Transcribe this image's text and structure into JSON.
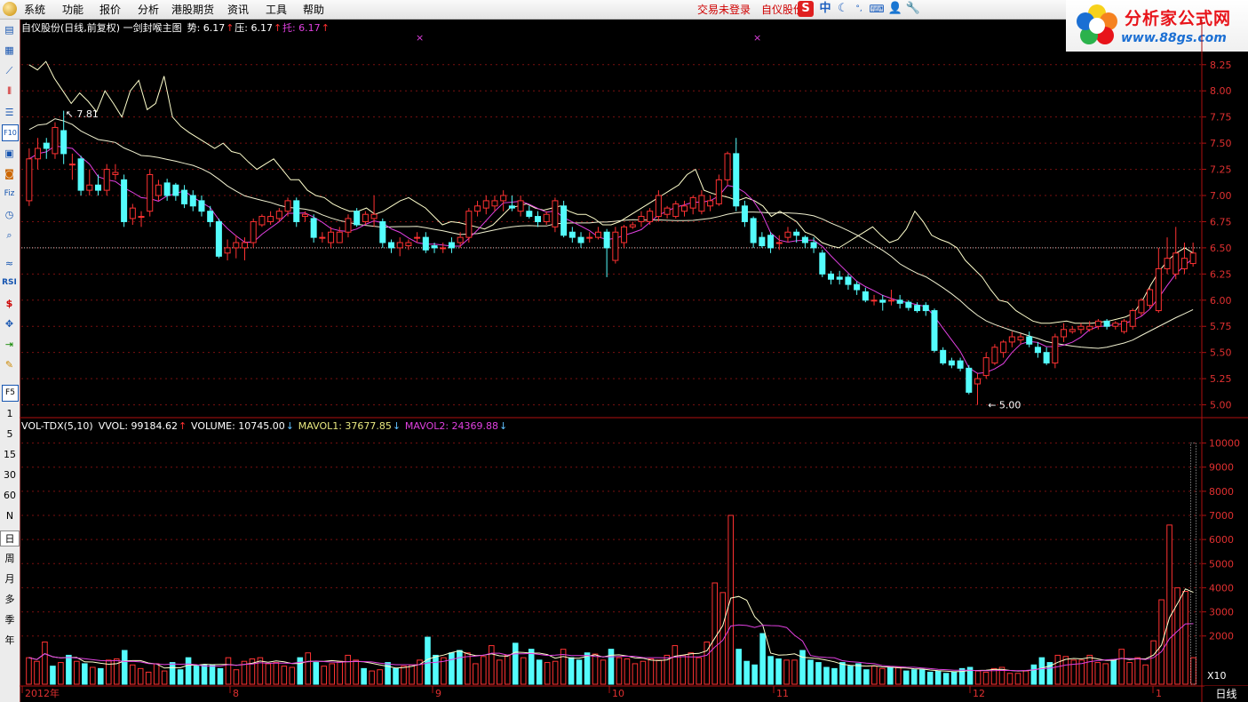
{
  "menu": [
    "系统",
    "功能",
    "报价",
    "分析",
    "港股期货",
    "资讯",
    "工具",
    "帮助"
  ],
  "trade_status": "交易未登录",
  "stock_tab": "自仪股份",
  "toolbar_icons": [
    "sina-s-icon",
    "chinese-input-icon",
    "moon-icon",
    "dot-icon",
    "keyboard-icon",
    "user-icon",
    "wrench-icon"
  ],
  "brand": {
    "title": "分析家公式网",
    "url": "www.88gs.com"
  },
  "sidebar": {
    "icons": [
      "report-icon",
      "grid-icon",
      "line-chart-icon",
      "candle-icon",
      "list-icon",
      "f10-icon",
      "news-icon",
      "info-icon",
      "fiz-icon",
      "clock-icon",
      "search-icon",
      "wave-icon",
      "rsi-icon",
      "dollar-icon",
      "move-icon",
      "export-icon",
      "pen-icon"
    ],
    "f10_label": "F10",
    "fiz_label": "Fiz",
    "rsi_label": "RSI",
    "f5_label": "F5",
    "periods": [
      "1",
      "5",
      "15",
      "30",
      "60",
      "N",
      "日",
      "周",
      "月",
      "多",
      "季",
      "年"
    ]
  },
  "price_panel": {
    "title": "自仪股份(日线,前复权) 一剑封喉主图",
    "indicators": [
      {
        "label": "势:",
        "value": "6.17",
        "arrow": "↑",
        "color": "#ffffff"
      },
      {
        "label": "压:",
        "value": "6.17",
        "arrow": "↑",
        "color": "#ffffff"
      },
      {
        "label": "托:",
        "value": "6.17",
        "arrow": "↑",
        "color": "#e040e0"
      }
    ],
    "high_label": "7.81",
    "low_label": "5.00",
    "ref_price": 6.5,
    "ylim": [
      4.92,
      8.35
    ],
    "ticks": [
      8.25,
      8.0,
      7.75,
      7.5,
      7.25,
      7.0,
      6.75,
      6.5,
      6.25,
      6.0,
      5.75,
      5.5,
      5.25,
      5.0
    ]
  },
  "volume_panel": {
    "title": "VOL-TDX(5,10)",
    "indicators": [
      {
        "label": "VVOL:",
        "value": "99184.62",
        "arrow": "↑",
        "color": "#ffffff"
      },
      {
        "label": "VOLUME:",
        "value": "10745.00",
        "arrow": "↓",
        "color": "#ffffff"
      },
      {
        "label": "MAVOL1:",
        "value": "37677.85",
        "arrow": "↓",
        "color": "#e8e880"
      },
      {
        "label": "MAVOL2:",
        "value": "24369.88",
        "arrow": "↓",
        "color": "#e040e0"
      }
    ],
    "ticks": [
      10000,
      9000,
      8000,
      7000,
      6000,
      5000,
      4000,
      3000,
      2000
    ],
    "unit": "X10",
    "ylim": [
      0,
      10500
    ]
  },
  "x_axis": {
    "labels": [
      "2012年",
      "8",
      "9",
      "10",
      "11",
      "12",
      "1"
    ],
    "period": "日线"
  },
  "colors": {
    "up": "#ff3232",
    "down": "#54fcfc",
    "ma_short": "#ffffcc",
    "ma_long": "#e040e0",
    "axis": "#b01010",
    "grid": "#7a1010"
  },
  "chart_data": {
    "type": "candlestick",
    "months": [
      "2012年",
      "8",
      "9",
      "10",
      "11",
      "12",
      "1"
    ],
    "candles": [
      {
        "o": 6.95,
        "c": 7.35,
        "h": 7.45,
        "l": 6.9
      },
      {
        "o": 7.35,
        "c": 7.45,
        "h": 7.55,
        "l": 7.25
      },
      {
        "o": 7.5,
        "c": 7.45,
        "h": 7.55,
        "l": 7.35
      },
      {
        "o": 7.4,
        "c": 7.65,
        "h": 7.7,
        "l": 7.35
      },
      {
        "o": 7.62,
        "c": 7.4,
        "h": 7.81,
        "l": 7.3
      },
      {
        "o": 7.3,
        "c": 7.3,
        "h": 7.4,
        "l": 7.15
      },
      {
        "o": 7.35,
        "c": 7.05,
        "h": 7.38,
        "l": 7.0
      },
      {
        "o": 7.05,
        "c": 7.1,
        "h": 7.25,
        "l": 7.0
      },
      {
        "o": 7.1,
        "c": 7.05,
        "h": 7.2,
        "l": 7.0
      },
      {
        "o": 7.05,
        "c": 7.25,
        "h": 7.3,
        "l": 7.0
      },
      {
        "o": 7.2,
        "c": 7.22,
        "h": 7.3,
        "l": 7.15
      },
      {
        "o": 7.15,
        "c": 6.75,
        "h": 7.2,
        "l": 6.7
      },
      {
        "o": 6.78,
        "c": 6.88,
        "h": 6.92,
        "l": 6.72
      },
      {
        "o": 6.8,
        "c": 6.8,
        "h": 6.85,
        "l": 6.7
      },
      {
        "o": 6.85,
        "c": 7.2,
        "h": 7.25,
        "l": 6.8
      },
      {
        "o": 7.0,
        "c": 7.1,
        "h": 7.15,
        "l": 6.95
      },
      {
        "o": 7.12,
        "c": 7.0,
        "h": 7.16,
        "l": 6.95
      },
      {
        "o": 7.1,
        "c": 7.0,
        "h": 7.12,
        "l": 6.95
      },
      {
        "o": 7.05,
        "c": 6.92,
        "h": 7.1,
        "l": 6.88
      },
      {
        "o": 7.0,
        "c": 6.9,
        "h": 7.05,
        "l": 6.85
      },
      {
        "o": 6.95,
        "c": 6.85,
        "h": 7.0,
        "l": 6.8
      },
      {
        "o": 6.85,
        "c": 6.75,
        "h": 6.9,
        "l": 6.7
      },
      {
        "o": 6.75,
        "c": 6.42,
        "h": 6.78,
        "l": 6.4
      },
      {
        "o": 6.45,
        "c": 6.5,
        "h": 6.58,
        "l": 6.38
      },
      {
        "o": 6.5,
        "c": 6.55,
        "h": 6.62,
        "l": 6.4
      },
      {
        "o": 6.5,
        "c": 6.55,
        "h": 6.6,
        "l": 6.38
      },
      {
        "o": 6.55,
        "c": 6.75,
        "h": 6.78,
        "l": 6.5
      },
      {
        "o": 6.72,
        "c": 6.8,
        "h": 6.82,
        "l": 6.7
      },
      {
        "o": 6.75,
        "c": 6.8,
        "h": 6.85,
        "l": 6.72
      },
      {
        "o": 6.78,
        "c": 6.85,
        "h": 6.88,
        "l": 6.75
      },
      {
        "o": 6.85,
        "c": 6.95,
        "h": 6.98,
        "l": 6.8
      },
      {
        "o": 6.95,
        "c": 6.75,
        "h": 6.98,
        "l": 6.7
      },
      {
        "o": 6.8,
        "c": 6.82,
        "h": 6.85,
        "l": 6.75
      },
      {
        "o": 6.78,
        "c": 6.6,
        "h": 6.82,
        "l": 6.55
      },
      {
        "o": 6.6,
        "c": 6.6,
        "h": 6.65,
        "l": 6.55
      },
      {
        "o": 6.55,
        "c": 6.65,
        "h": 6.7,
        "l": 6.5
      },
      {
        "o": 6.55,
        "c": 6.65,
        "h": 6.7,
        "l": 6.55
      },
      {
        "o": 6.65,
        "c": 6.78,
        "h": 6.82,
        "l": 6.6
      },
      {
        "o": 6.85,
        "c": 6.72,
        "h": 6.88,
        "l": 6.7
      },
      {
        "o": 6.75,
        "c": 6.82,
        "h": 6.85,
        "l": 6.72
      },
      {
        "o": 6.78,
        "c": 6.82,
        "h": 7.0,
        "l": 6.7
      },
      {
        "o": 6.75,
        "c": 6.55,
        "h": 6.78,
        "l": 6.5
      },
      {
        "o": 6.55,
        "c": 6.5,
        "h": 6.58,
        "l": 6.45
      },
      {
        "o": 6.5,
        "c": 6.55,
        "h": 6.6,
        "l": 6.42
      },
      {
        "o": 6.52,
        "c": 6.55,
        "h": 6.58,
        "l": 6.48
      },
      {
        "o": 6.6,
        "c": 6.6,
        "h": 6.65,
        "l": 6.55
      },
      {
        "o": 6.6,
        "c": 6.48,
        "h": 6.65,
        "l": 6.45
      },
      {
        "o": 6.52,
        "c": 6.5,
        "h": 6.55,
        "l": 6.45
      },
      {
        "o": 6.5,
        "c": 6.5,
        "h": 6.55,
        "l": 6.45
      },
      {
        "o": 6.55,
        "c": 6.5,
        "h": 6.6,
        "l": 6.45
      },
      {
        "o": 6.55,
        "c": 6.6,
        "h": 6.65,
        "l": 6.5
      },
      {
        "o": 6.6,
        "c": 6.85,
        "h": 6.88,
        "l": 6.55
      },
      {
        "o": 6.85,
        "c": 6.9,
        "h": 6.95,
        "l": 6.8
      },
      {
        "o": 6.88,
        "c": 6.95,
        "h": 7.0,
        "l": 6.82
      },
      {
        "o": 6.9,
        "c": 6.95,
        "h": 7.0,
        "l": 6.85
      },
      {
        "o": 6.95,
        "c": 7.0,
        "h": 7.05,
        "l": 6.85
      },
      {
        "o": 6.9,
        "c": 6.88,
        "h": 7.0,
        "l": 6.85
      },
      {
        "o": 6.85,
        "c": 6.95,
        "h": 7.0,
        "l": 6.8
      },
      {
        "o": 6.85,
        "c": 6.8,
        "h": 6.9,
        "l": 6.78
      },
      {
        "o": 6.8,
        "c": 6.75,
        "h": 6.85,
        "l": 6.7
      },
      {
        "o": 6.75,
        "c": 6.82,
        "h": 6.85,
        "l": 6.72
      },
      {
        "o": 6.7,
        "c": 6.95,
        "h": 6.98,
        "l": 6.65
      },
      {
        "o": 6.9,
        "c": 6.62,
        "h": 6.95,
        "l": 6.6
      },
      {
        "o": 6.65,
        "c": 6.6,
        "h": 6.7,
        "l": 6.55
      },
      {
        "o": 6.6,
        "c": 6.55,
        "h": 6.65,
        "l": 6.5
      },
      {
        "o": 6.6,
        "c": 6.6,
        "h": 6.65,
        "l": 6.55
      },
      {
        "o": 6.6,
        "c": 6.65,
        "h": 6.7,
        "l": 6.58
      },
      {
        "o": 6.65,
        "c": 6.5,
        "h": 6.68,
        "l": 6.22
      },
      {
        "o": 6.38,
        "c": 6.65,
        "h": 6.7,
        "l": 6.35
      },
      {
        "o": 6.55,
        "c": 6.7,
        "h": 6.72,
        "l": 6.5
      },
      {
        "o": 6.7,
        "c": 6.72,
        "h": 6.75,
        "l": 6.68
      },
      {
        "o": 6.75,
        "c": 6.8,
        "h": 6.85,
        "l": 6.7
      },
      {
        "o": 6.75,
        "c": 6.85,
        "h": 6.88,
        "l": 6.72
      },
      {
        "o": 6.8,
        "c": 7.0,
        "h": 7.05,
        "l": 6.75
      },
      {
        "o": 6.82,
        "c": 6.88,
        "h": 6.9,
        "l": 6.78
      },
      {
        "o": 6.8,
        "c": 6.92,
        "h": 6.95,
        "l": 6.78
      },
      {
        "o": 6.85,
        "c": 6.9,
        "h": 6.95,
        "l": 6.8
      },
      {
        "o": 6.88,
        "c": 6.98,
        "h": 7.0,
        "l": 6.82
      },
      {
        "o": 6.85,
        "c": 7.0,
        "h": 7.05,
        "l": 6.82
      },
      {
        "o": 6.9,
        "c": 6.95,
        "h": 7.0,
        "l": 6.85
      },
      {
        "o": 6.92,
        "c": 7.15,
        "h": 7.2,
        "l": 6.9
      },
      {
        "o": 7.15,
        "c": 7.4,
        "h": 7.42,
        "l": 7.1
      },
      {
        "o": 7.4,
        "c": 6.9,
        "h": 7.55,
        "l": 6.85
      },
      {
        "o": 6.9,
        "c": 6.75,
        "h": 6.95,
        "l": 6.7
      },
      {
        "o": 6.78,
        "c": 6.55,
        "h": 6.8,
        "l": 6.5
      },
      {
        "o": 6.6,
        "c": 6.52,
        "h": 6.65,
        "l": 6.5
      },
      {
        "o": 6.62,
        "c": 6.5,
        "h": 6.65,
        "l": 6.45
      },
      {
        "o": 6.55,
        "c": 6.55,
        "h": 6.62,
        "l": 6.48
      },
      {
        "o": 6.6,
        "c": 6.65,
        "h": 6.7,
        "l": 6.55
      },
      {
        "o": 6.65,
        "c": 6.62,
        "h": 6.68,
        "l": 6.55
      },
      {
        "o": 6.6,
        "c": 6.55,
        "h": 6.62,
        "l": 6.5
      },
      {
        "o": 6.55,
        "c": 6.5,
        "h": 6.6,
        "l": 6.45
      },
      {
        "o": 6.45,
        "c": 6.25,
        "h": 6.48,
        "l": 6.22
      },
      {
        "o": 6.25,
        "c": 6.2,
        "h": 6.28,
        "l": 6.15
      },
      {
        "o": 6.22,
        "c": 6.2,
        "h": 6.28,
        "l": 6.15
      },
      {
        "o": 6.22,
        "c": 6.15,
        "h": 6.25,
        "l": 6.1
      },
      {
        "o": 6.15,
        "c": 6.1,
        "h": 6.18,
        "l": 6.05
      },
      {
        "o": 6.08,
        "c": 6.0,
        "h": 6.12,
        "l": 5.98
      },
      {
        "o": 6.0,
        "c": 6.0,
        "h": 6.05,
        "l": 5.95
      },
      {
        "o": 6.0,
        "c": 5.98,
        "h": 6.05,
        "l": 5.9
      },
      {
        "o": 6.0,
        "c": 6.0,
        "h": 6.1,
        "l": 5.95
      },
      {
        "o": 6.0,
        "c": 5.97,
        "h": 6.05,
        "l": 5.92
      },
      {
        "o": 5.98,
        "c": 5.93,
        "h": 6.0,
        "l": 5.9
      },
      {
        "o": 5.95,
        "c": 5.9,
        "h": 5.98,
        "l": 5.88
      },
      {
        "o": 5.95,
        "c": 5.9,
        "h": 5.98,
        "l": 5.85
      },
      {
        "o": 5.9,
        "c": 5.52,
        "h": 5.92,
        "l": 5.5
      },
      {
        "o": 5.52,
        "c": 5.4,
        "h": 5.55,
        "l": 5.38
      },
      {
        "o": 5.42,
        "c": 5.38,
        "h": 5.45,
        "l": 5.35
      },
      {
        "o": 5.42,
        "c": 5.35,
        "h": 5.45,
        "l": 5.32
      },
      {
        "o": 5.35,
        "c": 5.12,
        "h": 5.38,
        "l": 5.1
      },
      {
        "o": 5.2,
        "c": 5.25,
        "h": 5.3,
        "l": 5.0
      },
      {
        "o": 5.28,
        "c": 5.45,
        "h": 5.5,
        "l": 5.25
      },
      {
        "o": 5.4,
        "c": 5.55,
        "h": 5.58,
        "l": 5.38
      },
      {
        "o": 5.5,
        "c": 5.6,
        "h": 5.62,
        "l": 5.45
      },
      {
        "o": 5.6,
        "c": 5.65,
        "h": 5.7,
        "l": 5.55
      },
      {
        "o": 5.62,
        "c": 5.65,
        "h": 5.68,
        "l": 5.58
      },
      {
        "o": 5.65,
        "c": 5.58,
        "h": 5.7,
        "l": 5.55
      },
      {
        "o": 5.55,
        "c": 5.5,
        "h": 5.6,
        "l": 5.45
      },
      {
        "o": 5.5,
        "c": 5.4,
        "h": 5.55,
        "l": 5.38
      },
      {
        "o": 5.4,
        "c": 5.65,
        "h": 5.68,
        "l": 5.35
      },
      {
        "o": 5.65,
        "c": 5.72,
        "h": 5.78,
        "l": 5.6
      },
      {
        "o": 5.7,
        "c": 5.72,
        "h": 5.75,
        "l": 5.68
      },
      {
        "o": 5.72,
        "c": 5.75,
        "h": 5.78,
        "l": 5.68
      },
      {
        "o": 5.72,
        "c": 5.75,
        "h": 5.8,
        "l": 5.7
      },
      {
        "o": 5.75,
        "c": 5.8,
        "h": 5.82,
        "l": 5.72
      },
      {
        "o": 5.8,
        "c": 5.75,
        "h": 5.82,
        "l": 5.72
      },
      {
        "o": 5.75,
        "c": 5.78,
        "h": 5.8,
        "l": 5.72
      },
      {
        "o": 5.7,
        "c": 5.8,
        "h": 5.82,
        "l": 5.68
      },
      {
        "o": 5.75,
        "c": 5.9,
        "h": 5.92,
        "l": 5.72
      },
      {
        "o": 5.88,
        "c": 6.0,
        "h": 6.02,
        "l": 5.85
      },
      {
        "o": 5.95,
        "c": 6.1,
        "h": 6.12,
        "l": 5.92
      },
      {
        "o": 5.9,
        "c": 6.3,
        "h": 6.5,
        "l": 5.88
      },
      {
        "o": 6.3,
        "c": 6.4,
        "h": 6.6,
        "l": 6.25
      },
      {
        "o": 6.25,
        "c": 6.45,
        "h": 6.7,
        "l": 6.2
      },
      {
        "o": 6.3,
        "c": 6.4,
        "h": 6.55,
        "l": 6.25
      },
      {
        "o": 6.35,
        "c": 6.45,
        "h": 6.55,
        "l": 6.32
      }
    ],
    "volumes": [
      1100,
      950,
      1750,
      750,
      900,
      1200,
      950,
      850,
      700,
      650,
      1000,
      1050,
      1400,
      800,
      650,
      500,
      850,
      550,
      900,
      600,
      1100,
      750,
      800,
      800,
      650,
      1100,
      600,
      950,
      1050,
      1100,
      850,
      900,
      750,
      700,
      1100,
      1300,
      900,
      750,
      850,
      950,
      1200,
      1000,
      650,
      550,
      600,
      900,
      650,
      750,
      800,
      1000,
      1950,
      1200,
      1100,
      1300,
      1400,
      1300,
      850,
      1150,
      1600,
      1000,
      1200,
      1700,
      1100,
      1450,
      1000,
      900,
      950,
      1450,
      1100,
      1000,
      1300,
      1250,
      1000,
      1450,
      1100,
      1050,
      850,
      950,
      1050,
      1000,
      1200,
      1600,
      1200,
      1300,
      1100,
      1750,
      4200,
      3800,
      7000,
      1450,
      950,
      800,
      2100,
      1150,
      1050,
      1000,
      1000,
      1400,
      1000,
      900,
      700,
      650,
      900,
      750,
      850,
      600,
      750,
      650,
      700,
      700,
      550,
      600,
      600,
      500,
      550,
      450,
      500,
      650,
      700,
      550,
      500,
      650,
      700,
      450,
      450,
      550,
      800,
      1100,
      900,
      1200,
      1150,
      1000,
      1000,
      1200,
      900,
      850,
      1000,
      1450,
      900,
      1100,
      800,
      1800,
      3500,
      6600,
      4000,
      3850,
      1100
    ],
    "ma_short_line": [
      8.25,
      8.2,
      8.28,
      8.12,
      8.0,
      7.88,
      7.98,
      7.9,
      7.8,
      8.0,
      7.88,
      7.75,
      8.0,
      8.1,
      7.82,
      7.88,
      8.14,
      7.75,
      7.66,
      7.6,
      7.55,
      7.5,
      7.45,
      7.5,
      7.42,
      7.4,
      7.32,
      7.25,
      7.3,
      7.35,
      7.25,
      7.15,
      7.15,
      7.05,
      7.0,
      6.98,
      6.92,
      6.88,
      6.85,
      6.85,
      6.88,
      6.82,
      6.85,
      6.9,
      6.95,
      6.98,
      6.93,
      6.88,
      6.8,
      6.72,
      6.75,
      6.74,
      6.72,
      6.7,
      6.68,
      6.72,
      6.8,
      6.88,
      6.9,
      6.92,
      6.88,
      6.86,
      6.88,
      6.9,
      6.85,
      6.82,
      6.82,
      6.78,
      6.72,
      6.72,
      6.75,
      6.8,
      6.85,
      6.9,
      6.95,
      7.0,
      7.05,
      7.1,
      7.2,
      7.25,
      7.05,
      7.02,
      7.0,
      6.98,
      6.95,
      6.98,
      6.95,
      6.9,
      6.8,
      6.85,
      6.8,
      6.75,
      6.65,
      6.62,
      6.55,
      6.52,
      6.5,
      6.55,
      6.6,
      6.65,
      6.7,
      6.62,
      6.55,
      6.58,
      6.68,
      6.85,
      6.75,
      6.62,
      6.58,
      6.55,
      6.5,
      6.38,
      6.3,
      6.22,
      6.1,
      6.0,
      5.98,
      5.9,
      5.85,
      5.8,
      5.78,
      5.78,
      5.79,
      5.8,
      5.78,
      5.78,
      5.78,
      5.79,
      5.8,
      5.82,
      5.84,
      5.88,
      6.0,
      6.15,
      6.28,
      6.38,
      6.45,
      6.5,
      6.45
    ]
  }
}
